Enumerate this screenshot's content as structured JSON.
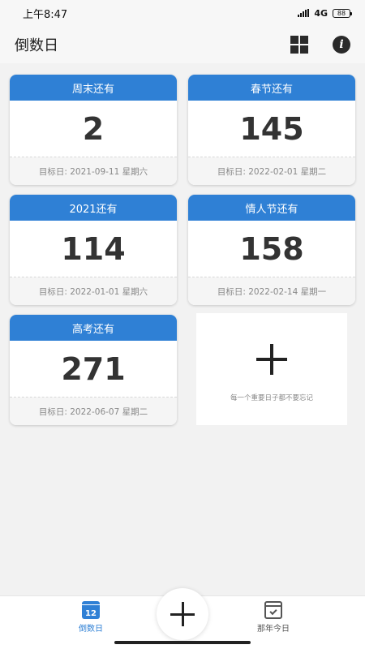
{
  "status_bar": {
    "time": "上午8:47",
    "network": "4G",
    "battery": "88"
  },
  "app_bar": {
    "title": "倒数日",
    "grid_icon": "grid-view-icon",
    "info_icon": "info-icon"
  },
  "cards": [
    {
      "label": "周末还有",
      "days": "2",
      "target": "目标日: 2021-09-11 星期六"
    },
    {
      "label": "春节还有",
      "days": "145",
      "target": "目标日: 2022-02-01 星期二"
    },
    {
      "label": "2021还有",
      "days": "114",
      "target": "目标日: 2022-01-01 星期六"
    },
    {
      "label": "情人节还有",
      "days": "158",
      "target": "目标日: 2022-02-14 星期一"
    },
    {
      "label": "高考还有",
      "days": "271",
      "target": "目标日: 2022-06-07 星期二"
    }
  ],
  "add_card": {
    "hint": "每一个重要日子都不要忘记"
  },
  "bottom_nav": {
    "left": {
      "label": "倒数日",
      "icon_text": "12"
    },
    "right": {
      "label": "那年今日"
    }
  },
  "colors": {
    "accent": "#2f80d5",
    "background": "#f2f2f2"
  }
}
